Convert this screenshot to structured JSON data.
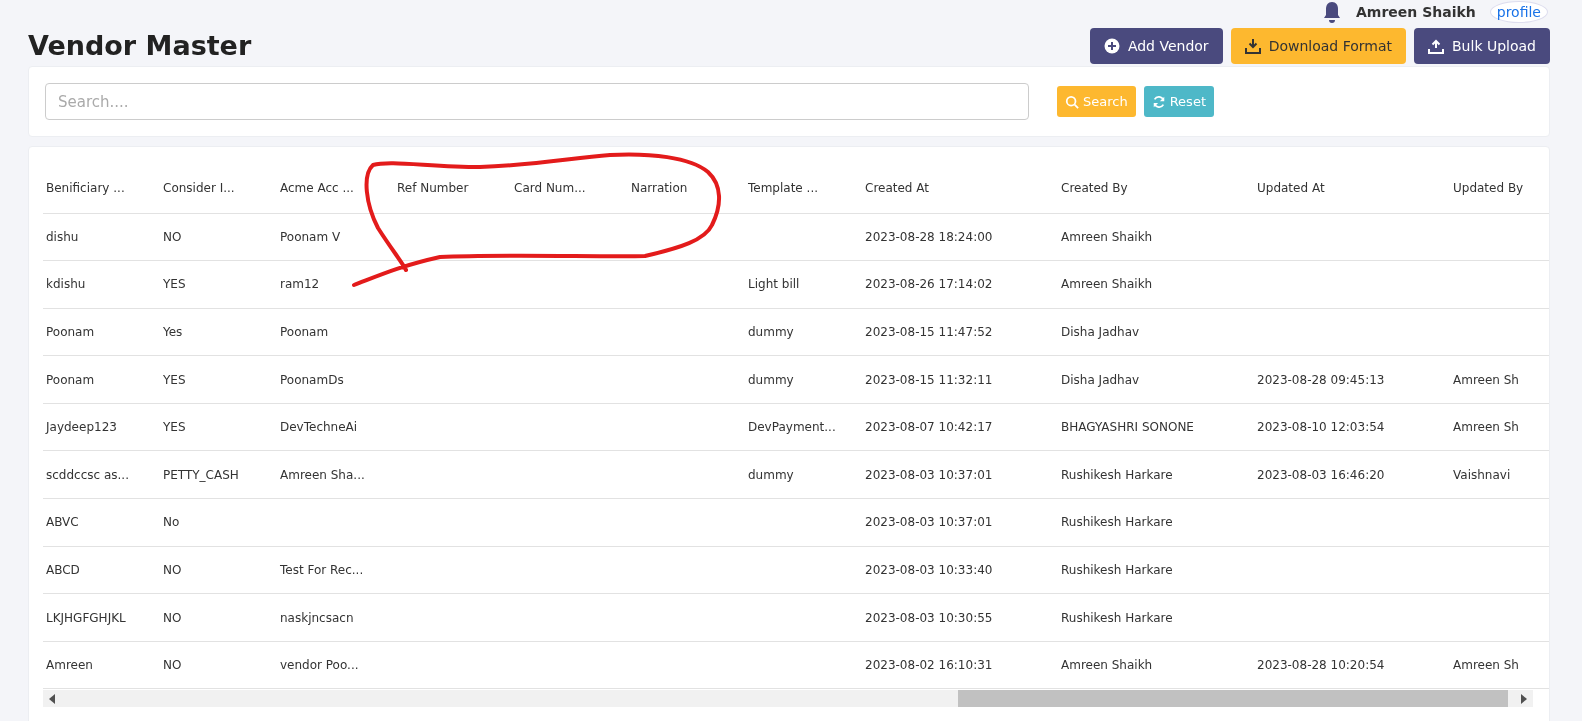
{
  "user_bar": {
    "user_name": "Amreen Shaikh",
    "avatar_alt": "profile"
  },
  "page_title": "Vendor Master",
  "actions": [
    {
      "kind": "add",
      "label": "Add Vendor"
    },
    {
      "kind": "download",
      "label": "Download Format"
    },
    {
      "kind": "upload",
      "label": "Bulk Upload"
    }
  ],
  "search": {
    "placeholder": "Search....",
    "buttons": [
      {
        "kind": "search",
        "label": "Search"
      },
      {
        "kind": "reset",
        "label": "Reset"
      }
    ]
  },
  "table": {
    "columns": [
      "Benificiary ...",
      "Consider I...",
      "Acme Acc ...",
      "Ref Number",
      "Card Num...",
      "Narration",
      "Template ...",
      "Created At",
      "Created By",
      "Updated At",
      "Updated By"
    ],
    "rows": [
      [
        "dishu",
        "NO",
        "Poonam V",
        null,
        null,
        null,
        null,
        "2023-08-28 18:24:00",
        "Amreen Shaikh",
        null,
        null
      ],
      [
        "kdishu",
        "YES",
        "ram12",
        null,
        null,
        null,
        "Light bill",
        "2023-08-26 17:14:02",
        "Amreen Shaikh",
        null,
        null
      ],
      [
        "Poonam",
        "Yes",
        "Poonam",
        null,
        null,
        null,
        "dummy",
        "2023-08-15 11:47:52",
        "Disha Jadhav",
        null,
        null
      ],
      [
        "Poonam",
        "YES",
        "PoonamDs",
        null,
        null,
        null,
        "dummy",
        "2023-08-15 11:32:11",
        "Disha Jadhav",
        "2023-08-28 09:45:13",
        "Amreen Sh"
      ],
      [
        "Jaydeep123",
        "YES",
        "DevTechneAi",
        null,
        null,
        null,
        "DevPayment...",
        "2023-08-07 10:42:17",
        "BHAGYASHRI SONONE",
        "2023-08-10 12:03:54",
        "Amreen Sh"
      ],
      [
        "scddccsc as...",
        "PETTY_CASH",
        "Amreen Sha...",
        null,
        null,
        null,
        "dummy",
        "2023-08-03 10:37:01",
        "Rushikesh Harkare",
        "2023-08-03 16:46:20",
        "Vaishnavi"
      ],
      [
        "ABVC",
        "No",
        null,
        null,
        null,
        null,
        null,
        "2023-08-03 10:37:01",
        "Rushikesh Harkare",
        null,
        null
      ],
      [
        "ABCD",
        "NO",
        "Test For Rec...",
        null,
        null,
        null,
        null,
        "2023-08-03 10:33:40",
        "Rushikesh Harkare",
        null,
        null
      ],
      [
        "LKJHGFGHJKL",
        "NO",
        "naskjncsacn",
        null,
        null,
        null,
        null,
        "2023-08-03 10:30:55",
        "Rushikesh Harkare",
        null,
        null
      ],
      [
        "Amreen",
        "NO",
        "vendor Poo...",
        null,
        null,
        null,
        null,
        "2023-08-02 16:10:31",
        "Amreen Shaikh",
        "2023-08-28 10:20:54",
        "Amreen Sh"
      ]
    ]
  }
}
